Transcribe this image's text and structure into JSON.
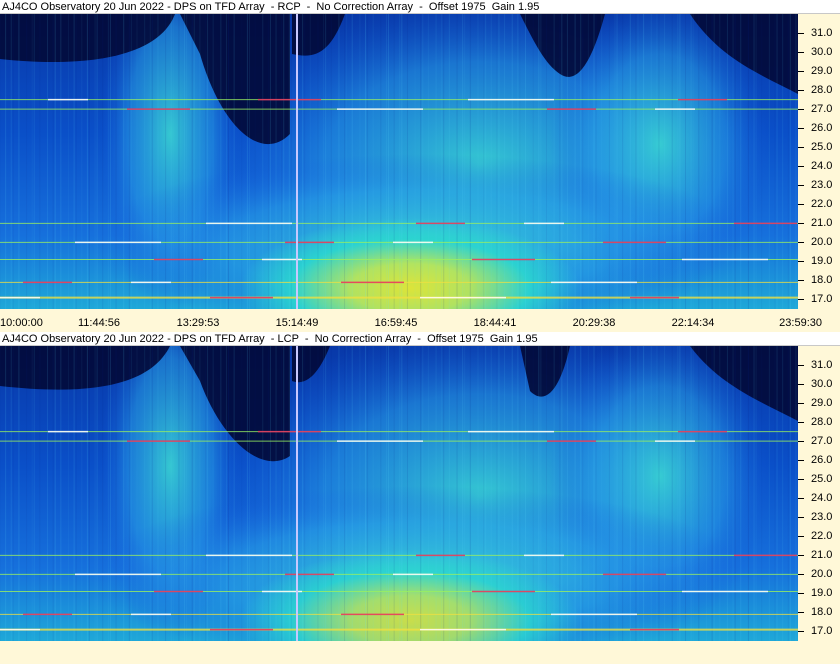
{
  "colors": {
    "background": "#fff8d8",
    "plot_low": "#020a3a",
    "plot_mid": "#0a5ad8",
    "plot_high": "#2bd4d0",
    "plot_hot": "#e6e830",
    "marker_line": "#c8c8ff"
  },
  "chart_data": [
    {
      "type": "heatmap",
      "title": "AJ4CO Observatory 20 Jun 2022 - DPS on TFD Array  - RCP  -  No Correction Array  -  Offset 1975  Gain 1.95",
      "y_ticks": [
        "31.0",
        "30.0",
        "29.0",
        "28.0",
        "27.0",
        "26.0",
        "25.0",
        "24.0",
        "23.0",
        "22.0",
        "21.0",
        "20.0",
        "19.0",
        "18.0",
        "17.0"
      ],
      "ylim": [
        16.5,
        32.0
      ],
      "x_ticks": [
        "10:00:00",
        "11:44:56",
        "13:29:53",
        "15:14:49",
        "16:59:45",
        "18:44:41",
        "20:29:38",
        "22:14:34",
        "23:59:30"
      ],
      "marker_time": "15:14:49",
      "constant_signal_freqs": [
        17.1,
        17.9,
        19.1,
        20.0,
        21.0,
        27.0,
        27.5
      ]
    },
    {
      "type": "heatmap",
      "title": "AJ4CO Observatory 20 Jun 2022 - DPS on TFD Array  - LCP  -  No Correction Array  -  Offset 1975  Gain 1.95",
      "y_ticks": [
        "31.0",
        "30.0",
        "29.0",
        "28.0",
        "27.0",
        "26.0",
        "25.0",
        "24.0",
        "23.0",
        "22.0",
        "21.0",
        "20.0",
        "19.0",
        "18.0",
        "17.0"
      ],
      "ylim": [
        16.5,
        32.0
      ],
      "x_ticks": [],
      "marker_time": "15:14:49",
      "constant_signal_freqs": [
        17.1,
        17.9,
        19.1,
        20.0,
        21.0,
        27.0,
        27.5
      ]
    }
  ]
}
